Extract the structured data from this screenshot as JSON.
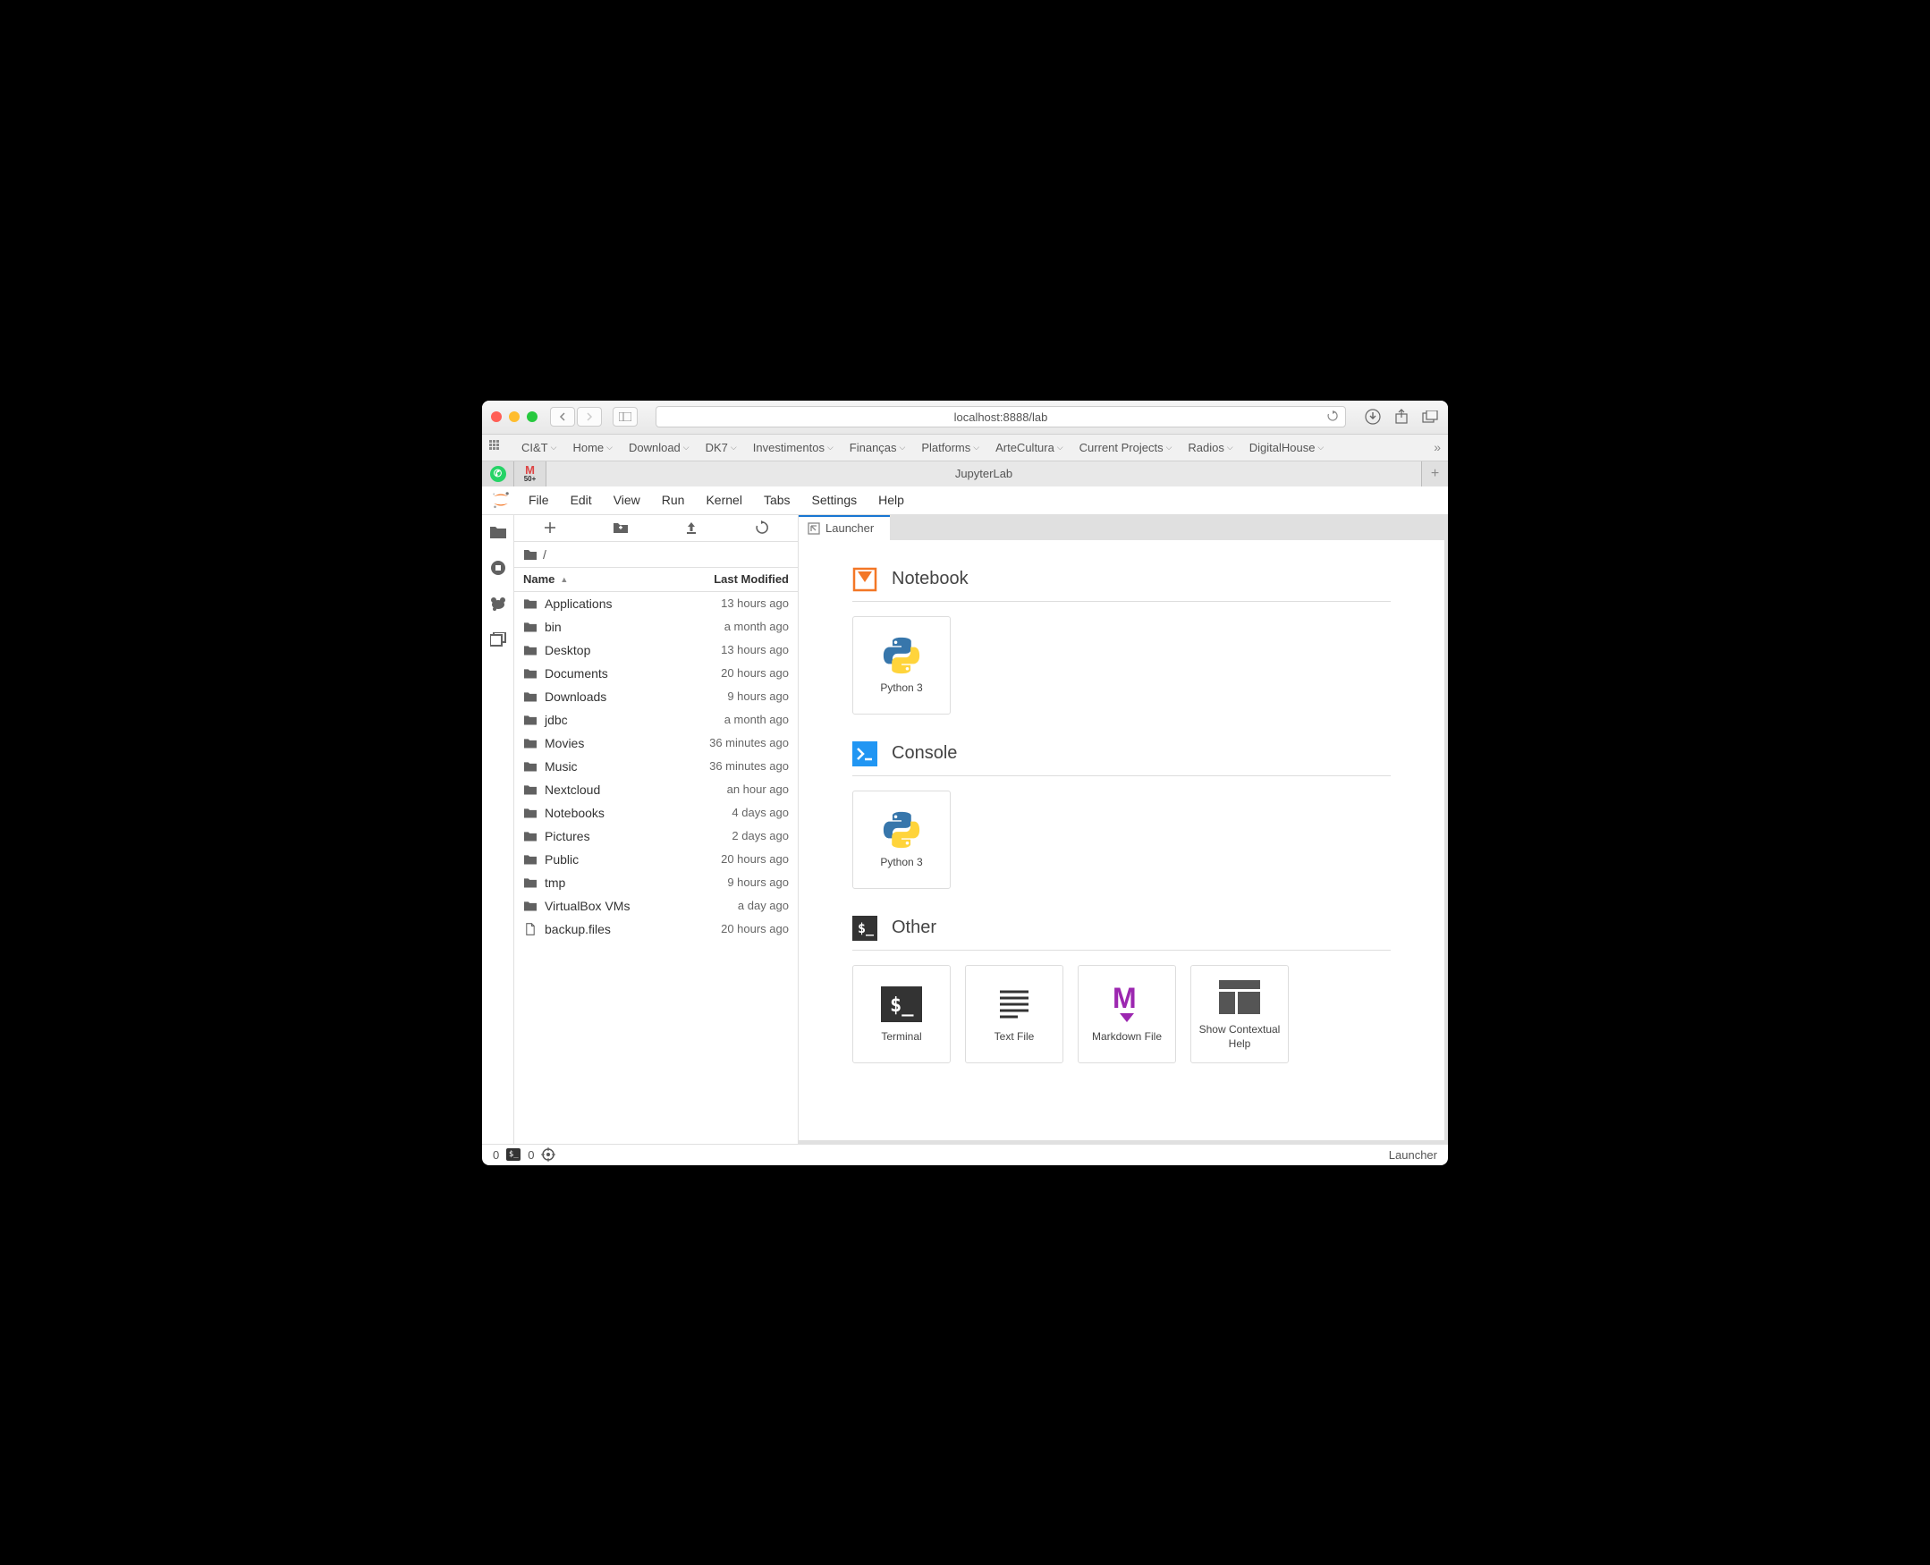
{
  "browser": {
    "address": "localhost:8888/lab",
    "bookmarks": [
      "CI&T",
      "Home",
      "Download",
      "DK7",
      "Investimentos",
      "Finanças",
      "Platforms",
      "ArteCultura",
      "Current Projects",
      "Radios",
      "DigitalHouse"
    ],
    "tab_title": "JupyterLab",
    "gmail_badge": "50+"
  },
  "menu": [
    "File",
    "Edit",
    "View",
    "Run",
    "Kernel",
    "Tabs",
    "Settings",
    "Help"
  ],
  "filebrowser": {
    "crumb": "/",
    "col_name": "Name",
    "col_modified": "Last Modified",
    "items": [
      {
        "name": "Applications",
        "type": "folder",
        "modified": "13 hours ago"
      },
      {
        "name": "bin",
        "type": "folder",
        "modified": "a month ago"
      },
      {
        "name": "Desktop",
        "type": "folder",
        "modified": "13 hours ago"
      },
      {
        "name": "Documents",
        "type": "folder",
        "modified": "20 hours ago"
      },
      {
        "name": "Downloads",
        "type": "folder",
        "modified": "9 hours ago"
      },
      {
        "name": "jdbc",
        "type": "folder",
        "modified": "a month ago"
      },
      {
        "name": "Movies",
        "type": "folder",
        "modified": "36 minutes ago"
      },
      {
        "name": "Music",
        "type": "folder",
        "modified": "36 minutes ago"
      },
      {
        "name": "Nextcloud",
        "type": "folder",
        "modified": "an hour ago"
      },
      {
        "name": "Notebooks",
        "type": "folder",
        "modified": "4 days ago"
      },
      {
        "name": "Pictures",
        "type": "folder",
        "modified": "2 days ago"
      },
      {
        "name": "Public",
        "type": "folder",
        "modified": "20 hours ago"
      },
      {
        "name": "tmp",
        "type": "folder",
        "modified": "9 hours ago"
      },
      {
        "name": "VirtualBox VMs",
        "type": "folder",
        "modified": "a day ago"
      },
      {
        "name": "backup.files",
        "type": "file",
        "modified": "20 hours ago"
      }
    ]
  },
  "launcher": {
    "tab_label": "Launcher",
    "sections": {
      "notebook": {
        "title": "Notebook",
        "cards": [
          {
            "label": "Python 3"
          }
        ]
      },
      "console": {
        "title": "Console",
        "cards": [
          {
            "label": "Python 3"
          }
        ]
      },
      "other": {
        "title": "Other",
        "cards": [
          {
            "label": "Terminal"
          },
          {
            "label": "Text File"
          },
          {
            "label": "Markdown File"
          },
          {
            "label": "Show Contextual Help"
          }
        ]
      }
    }
  },
  "statusbar": {
    "terminals": "0",
    "kernels": "0",
    "right": "Launcher"
  }
}
